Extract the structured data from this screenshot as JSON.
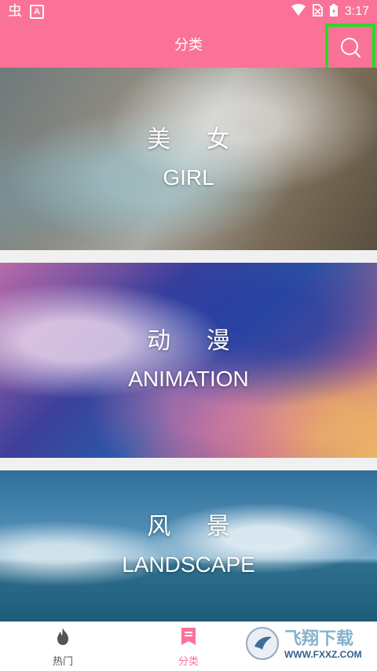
{
  "status_bar": {
    "app_icon_glyph": "虫",
    "notification_letter": "A",
    "time": "3:17",
    "icons": [
      "wifi-icon",
      "no-sim-icon",
      "battery-charging-icon"
    ]
  },
  "app_bar": {
    "title": "分类",
    "search_icon": "search-icon",
    "background_color": "#fb7299"
  },
  "categories": [
    {
      "name_cn": "美 女",
      "name_en": "GIRL"
    },
    {
      "name_cn": "动 漫",
      "name_en": "ANIMATION"
    },
    {
      "name_cn": "风 景",
      "name_en": "LANDSCAPE"
    }
  ],
  "bottom_nav": {
    "items": [
      {
        "label": "热门",
        "icon": "flame-icon",
        "active": false
      },
      {
        "label": "分类",
        "icon": "list-icon",
        "active": true
      }
    ],
    "active_color": "#fb7299"
  },
  "watermark": {
    "text_cn": "飞翔下载",
    "url": "WWW.FXXZ.COM"
  }
}
